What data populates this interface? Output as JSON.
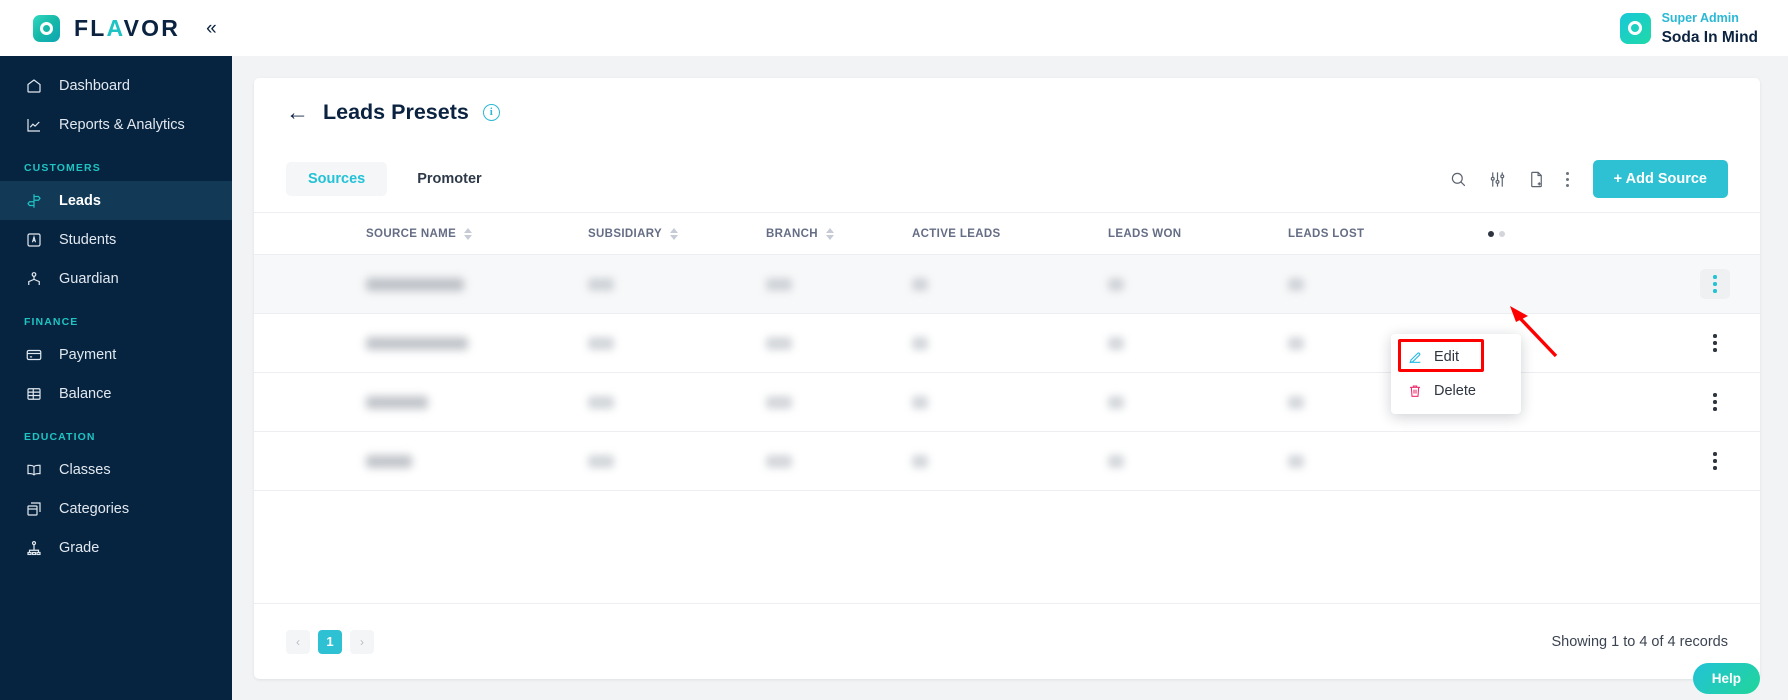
{
  "brand": {
    "name_prefix": "FL",
    "name_accent": "A",
    "name_suffix": "VOR",
    "logo_icon": "flavor-ring-logo",
    "collapse_icon": "«",
    "accent_color": "#1fc3c3"
  },
  "user": {
    "role": "Super Admin",
    "name": "Soda In Mind",
    "avatar_icon": "ring-avatar"
  },
  "sidebar": {
    "items": [
      {
        "label": "Dashboard",
        "icon": "home-icon",
        "active": false,
        "type": "item"
      },
      {
        "label": "Reports & Analytics",
        "icon": "chart-line-icon",
        "active": false,
        "type": "item"
      },
      {
        "label": "CUSTOMERS",
        "type": "section"
      },
      {
        "label": "Leads",
        "icon": "signpost-icon",
        "active": true,
        "type": "item"
      },
      {
        "label": "Students",
        "icon": "id-badge-icon",
        "active": false,
        "type": "item"
      },
      {
        "label": "Guardian",
        "icon": "guardian-icon",
        "active": false,
        "type": "item"
      },
      {
        "label": "FINANCE",
        "type": "section"
      },
      {
        "label": "Payment",
        "icon": "credit-card-icon",
        "active": false,
        "type": "item"
      },
      {
        "label": "Balance",
        "icon": "balance-sheet-icon",
        "active": false,
        "type": "item"
      },
      {
        "label": "EDUCATION",
        "type": "section"
      },
      {
        "label": "Classes",
        "icon": "book-open-icon",
        "active": false,
        "type": "item"
      },
      {
        "label": "Categories",
        "icon": "boxes-icon",
        "active": false,
        "type": "item"
      },
      {
        "label": "Grade",
        "icon": "hierarchy-icon",
        "active": false,
        "type": "item"
      }
    ]
  },
  "page": {
    "title": "Leads Presets",
    "back_icon": "arrow-left-icon",
    "info_icon": "info-circle-icon",
    "info_glyph": "i"
  },
  "toolbar": {
    "tabs": [
      {
        "label": "Sources",
        "active": true
      },
      {
        "label": "Promoter",
        "active": false
      }
    ],
    "icons": [
      {
        "name": "search-icon"
      },
      {
        "name": "filter-sliders-icon"
      },
      {
        "name": "document-add-icon"
      },
      {
        "name": "more-vertical-icon"
      }
    ],
    "add_button": "+ Add Source"
  },
  "table": {
    "columns": [
      {
        "label": "SOURCE NAME",
        "sortable": true
      },
      {
        "label": "SUBSIDIARY",
        "sortable": true
      },
      {
        "label": "BRANCH",
        "sortable": true
      },
      {
        "label": "ACTIVE LEADS",
        "sortable": false
      },
      {
        "label": "LEADS WON",
        "sortable": false
      },
      {
        "label": "LEADS LOST",
        "sortable": false
      }
    ],
    "carousel_dots": 2,
    "carousel_active_index": 0,
    "rows": [
      {
        "redacted": true,
        "name_width": 98,
        "highlighted": true,
        "menu_open": true
      },
      {
        "redacted": true,
        "name_width": 102,
        "highlighted": false,
        "menu_open": false
      },
      {
        "redacted": true,
        "name_width": 62,
        "highlighted": false,
        "menu_open": false
      },
      {
        "redacted": true,
        "name_width": 46,
        "highlighted": false,
        "menu_open": false
      }
    ]
  },
  "row_menu": {
    "items": [
      {
        "label": "Edit",
        "icon": "pencil-icon",
        "color": "#22b8e0",
        "highlighted": true
      },
      {
        "label": "Delete",
        "icon": "trash-icon",
        "color": "#ee2a6e",
        "highlighted": false
      }
    ]
  },
  "footer": {
    "prev_label": "‹",
    "next_label": "›",
    "current_page": "1",
    "records_text": "Showing 1 to 4 of 4 records"
  },
  "help": {
    "label": "Help"
  },
  "annotation": {
    "arrow_color": "#ff0000",
    "highlight_color": "#ff0000"
  }
}
